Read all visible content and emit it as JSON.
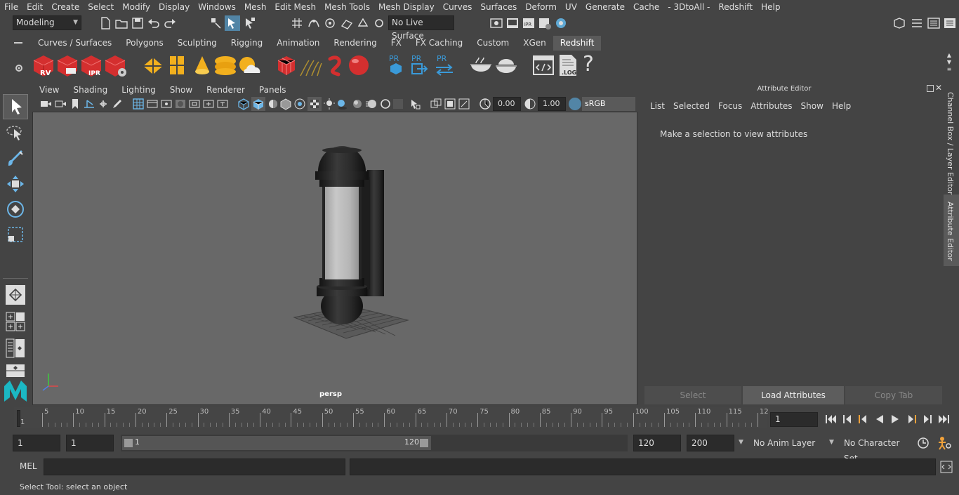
{
  "menu": {
    "items": [
      "File",
      "Edit",
      "Create",
      "Select",
      "Modify",
      "Display",
      "Windows",
      "Mesh",
      "Edit Mesh",
      "Mesh Tools",
      "Mesh Display",
      "Curves",
      "Surfaces",
      "Deform",
      "UV",
      "Generate",
      "Cache",
      "- 3DtoAll -",
      "Redshift",
      "Help"
    ]
  },
  "status": {
    "mode": "Modeling",
    "live_surface": "No Live Surface"
  },
  "shelf": {
    "tabs": [
      "Curves / Surfaces",
      "Polygons",
      "Sculpting",
      "Rigging",
      "Animation",
      "Rendering",
      "FX",
      "FX Caching",
      "Custom",
      "XGen",
      "Redshift"
    ],
    "active_tab": "Redshift",
    "icon_labels": {
      "rv": "RV",
      "ipr": "IPR",
      "pr": "PR",
      "log": ".LOG",
      "help": "?"
    }
  },
  "viewport": {
    "menus": [
      "View",
      "Shading",
      "Lighting",
      "Show",
      "Renderer",
      "Panels"
    ],
    "exposure": "0.00",
    "gamma": "1.00",
    "color_space": "sRGB gamma",
    "camera_label": "persp"
  },
  "attribute_editor": {
    "title": "Attribute Editor",
    "menus": [
      "List",
      "Selected",
      "Focus",
      "Attributes",
      "Show",
      "Help"
    ],
    "message": "Make a selection to view attributes",
    "buttons": {
      "select": "Select",
      "load": "Load Attributes",
      "copy": "Copy Tab"
    },
    "side_tabs": {
      "channel_box": "Channel Box / Layer Editor",
      "attribute_editor": "Attribute Editor"
    }
  },
  "timeline": {
    "ticks": [
      "1",
      "5",
      "10",
      "15",
      "20",
      "25",
      "30",
      "35",
      "40",
      "45",
      "50",
      "55",
      "60",
      "65",
      "70",
      "75",
      "80",
      "85",
      "90",
      "95",
      "100",
      "105",
      "110",
      "115",
      "12"
    ],
    "current_frame": "1"
  },
  "range": {
    "start": "1",
    "playback_start": "1",
    "slider_start": "1",
    "slider_end": "120",
    "playback_end": "120",
    "end": "200",
    "anim_layer": "No Anim Layer",
    "character_set": "No Character Set"
  },
  "command": {
    "language": "MEL"
  },
  "help_line": {
    "text": "Select Tool: select an object"
  },
  "colors": {
    "accent": "#5285a6",
    "active_tab": "#5a5a5a",
    "viewport_bg": "#686868",
    "redshift_red": "#d42f2f",
    "shelf_yellow": "#f2b01e"
  }
}
